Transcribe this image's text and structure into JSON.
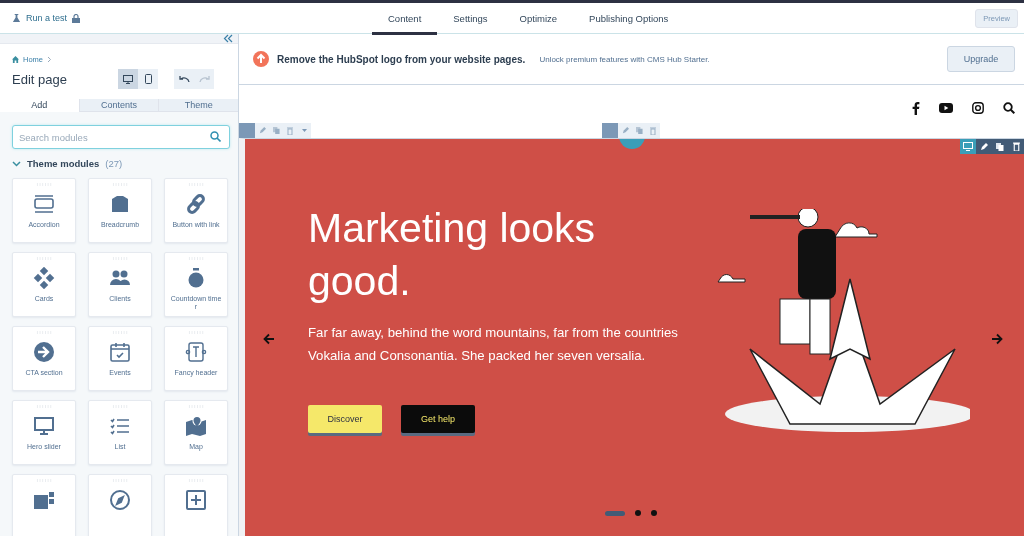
{
  "top_bar": {
    "test_link": "Run a test",
    "tabs": [
      {
        "label": "Content",
        "selected": true
      },
      {
        "label": "Settings",
        "selected": false
      },
      {
        "label": "Optimize",
        "selected": false
      },
      {
        "label": "Publishing Options",
        "selected": false
      }
    ],
    "preview_button": "Preview"
  },
  "sidebar": {
    "breadcrumb": "Home",
    "title": "Edit page",
    "devices": [
      {
        "kind": "desktop",
        "selected": true
      },
      {
        "kind": "mobile",
        "selected": false
      }
    ],
    "tabs": [
      {
        "label": "Add",
        "selected": true
      },
      {
        "label": "Contents",
        "selected": false
      },
      {
        "label": "Theme",
        "selected": false
      }
    ],
    "search": {
      "placeholder": "Search modules"
    },
    "section": {
      "label": "Theme modules",
      "count": "(27)",
      "expanded": true
    },
    "modules": [
      "Accordion",
      "Breadcrumb",
      "Button with link",
      "Cards",
      "Clients",
      "Countdown time r",
      "CTA section",
      "Events",
      "Fancy header",
      "Hero slider",
      "List",
      "Map"
    ]
  },
  "banner": {
    "title": "Remove the HubSpot logo from your website pages.",
    "text": "Unlock premium features with CMS Hub Starter.",
    "button": "Upgrade"
  },
  "hero": {
    "title": "Marketing looks good.",
    "text": "Far far away, behind the word mountains, far from the countries Vokalia and Consonantia. She packed her seven versalia.",
    "buttons": [
      {
        "label": "Discover",
        "kind": "primary"
      },
      {
        "label": "Get help",
        "kind": "dark"
      }
    ],
    "dots": [
      {
        "selected": true
      },
      {
        "selected": false
      },
      {
        "selected": false
      }
    ]
  }
}
